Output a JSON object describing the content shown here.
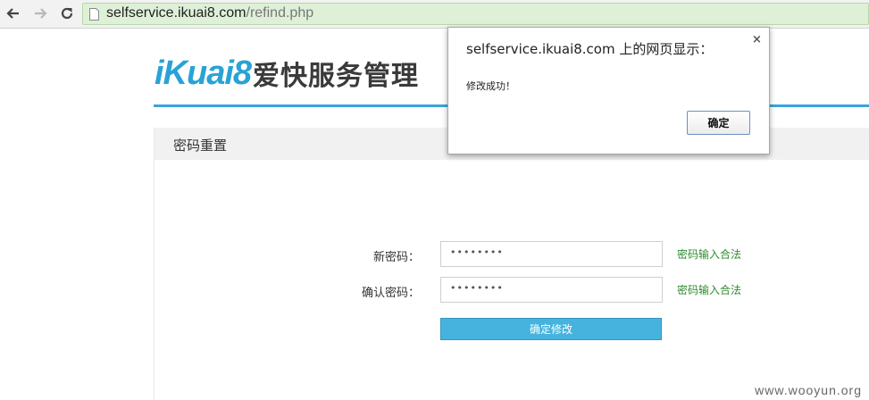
{
  "browser": {
    "url_host": "selfservice.ikuai8.com",
    "url_path": "/refind.php"
  },
  "logo": {
    "latin": "iKuai8",
    "chinese": "爱快服务管理"
  },
  "panel": {
    "title": "密码重置"
  },
  "form": {
    "new_password_label": "新密码：",
    "new_password_value": "••••••••",
    "new_password_hint": "密码输入合法",
    "confirm_password_label": "确认密码：",
    "confirm_password_value": "••••••••",
    "confirm_password_hint": "密码输入合法",
    "submit_label": "确定修改"
  },
  "dialog": {
    "title": "selfservice.ikuai8.com 上的网页显示：",
    "close_glyph": "×",
    "message": "修改成功！",
    "ok_label": "确定"
  },
  "watermark": "www.wooyun.org",
  "colors": {
    "accent_blue": "#3aa4d6",
    "button_blue": "#45b3de",
    "hint_green": "#2f8b2f",
    "omnibox_green": "#dff0d8"
  },
  "icons": [
    "back-arrow-icon",
    "forward-arrow-icon",
    "reload-icon",
    "page-icon"
  ]
}
